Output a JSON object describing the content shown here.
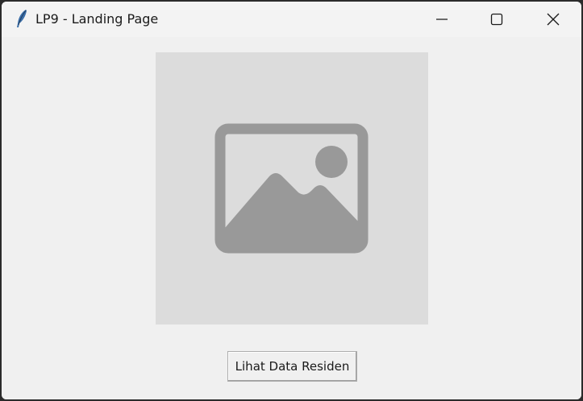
{
  "window": {
    "title": "LP9 - Landing Page",
    "app_icon": "feather-icon"
  },
  "controls": {
    "minimize_icon": "minimize-icon",
    "maximize_icon": "maximize-icon",
    "close_icon": "close-icon"
  },
  "main": {
    "image_icon": "image-placeholder-icon",
    "button_label": "Lihat Data Residen"
  },
  "colors": {
    "window_bg": "#f0f0f0",
    "placeholder_bg": "#dcdcdc",
    "placeholder_icon": "#999999"
  }
}
